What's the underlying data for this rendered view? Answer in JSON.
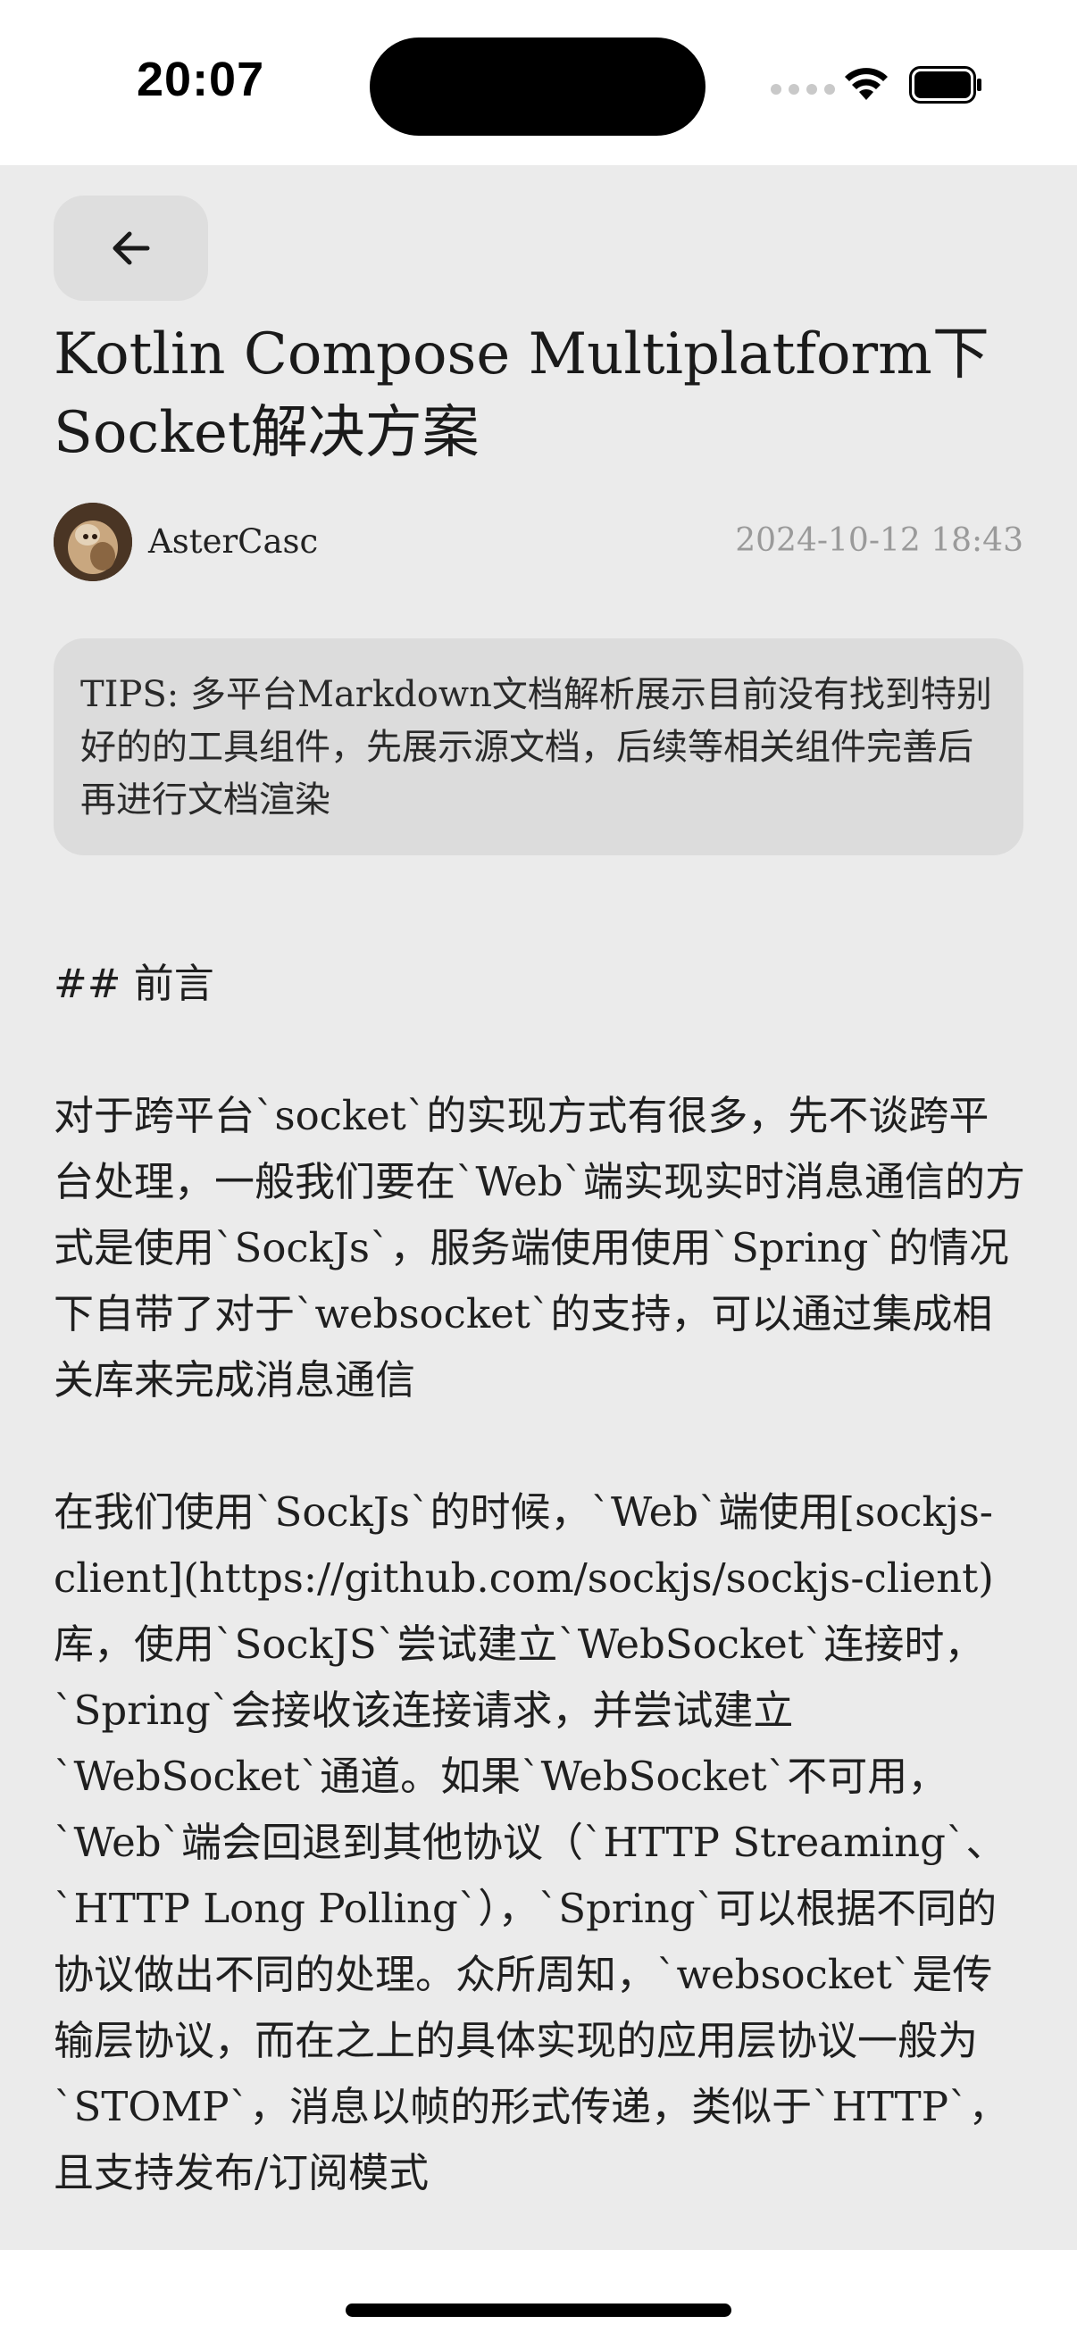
{
  "status_bar": {
    "time": "20:07",
    "icons": [
      "cellular-signal-icon",
      "wifi-icon",
      "battery-icon"
    ]
  },
  "nav": {
    "back_icon": "arrow-left-icon"
  },
  "article": {
    "title": "Kotlin Compose Multiplatform下Socket解决方案",
    "author": "AsterCasc",
    "date": "2024-10-12 18:43",
    "tips": "TIPS: 多平台Markdown文档解析展示目前没有找到特别好的的工具组件，先展示源文档，后续等相关组件完善后再进行文档渲染",
    "heading": "## 前言",
    "paragraph1": "对于跨平台`socket`的实现方式有很多，先不谈跨平台处理，一般我们要在`Web`端实现实时消息通信的方式是使用`SockJs`，服务端使用使用`Spring`的情况下自带了对于`websocket`的支持，可以通过集成相关库来完成消息通信",
    "paragraph2": "在我们使用`SockJs`的时候，`Web`端使用[sockjs-client](https://github.com/sockjs/sockjs-client)库，使用`SockJS`尝试建立`WebSocket`连接时，`Spring`会接收该连接请求，并尝试建立`WebSocket`通道。如果`WebSocket`不可用，`Web`端会回退到其他协议（`HTTP Streaming`、`HTTP Long Polling`），`Spring`可以根据不同的协议做出不同的处理。众所周知，`websocket`是传输层协议，而在之上的具体实现的应用层协议一般为`STOMP`，消息以帧的形式传递，类似于`HTTP`，且支持发布/订阅模式"
  },
  "colors": {
    "background": "#ebebeb",
    "card": "#dcdcdc",
    "date": "#9a9a9a"
  }
}
